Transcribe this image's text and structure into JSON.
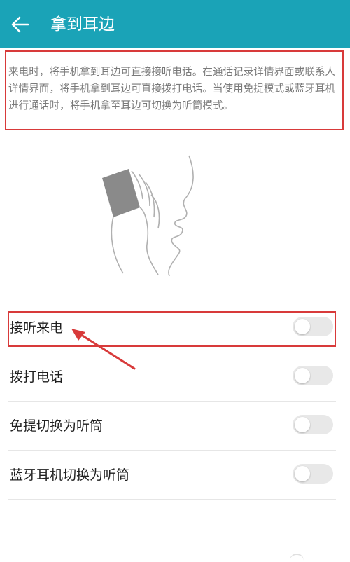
{
  "header": {
    "title": "拿到耳边",
    "back_icon": "back-arrow-icon"
  },
  "description": "来电时，将手机拿到耳边可直接接听电话。在通话记录详情界面或联系人详情界面，将手机拿到耳边可直接拨打电话。当使用免提模式或蓝牙耳机进行通话时，将手机拿至耳边可切换为听筒模式。",
  "settings": [
    {
      "label": "接听来电",
      "enabled": false
    },
    {
      "label": "拨打电话",
      "enabled": false
    },
    {
      "label": "免提切换为听筒",
      "enabled": false
    },
    {
      "label": "蓝牙耳机切换为听筒",
      "enabled": false
    }
  ],
  "colors": {
    "appbar": "#1aa3b7",
    "annotation": "#d83a3a"
  }
}
